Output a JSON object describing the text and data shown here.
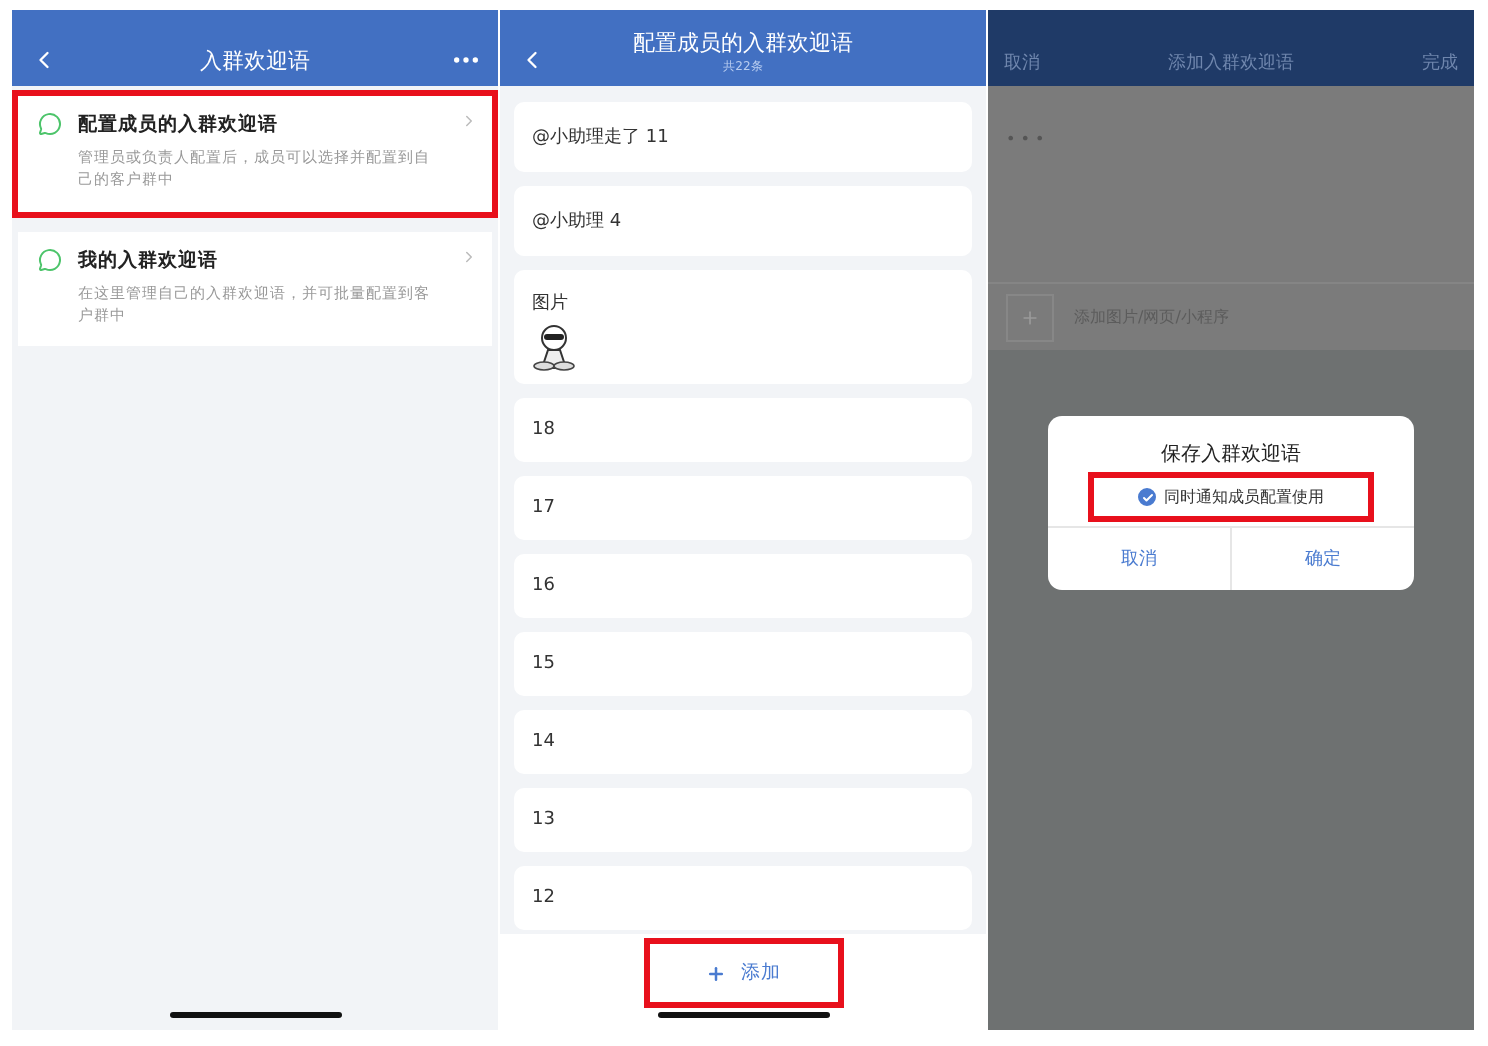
{
  "menu_screen": {
    "title": "入群欢迎语",
    "items": [
      {
        "title": "配置成员的入群欢迎语",
        "description": "管理员或负责人配置后，成员可以选择并配置到自己的客户群中",
        "highlighted": true
      },
      {
        "title": "我的入群欢迎语",
        "description": "在这里管理自己的入群欢迎语，并可批量配置到客户群中",
        "highlighted": false
      }
    ]
  },
  "list_screen": {
    "title": "配置成员的入群欢迎语",
    "subtitle": "共22条",
    "items": [
      {
        "kind": "text",
        "text": "@小助理走了 11"
      },
      {
        "kind": "text",
        "text": "@小助理 4"
      },
      {
        "text": "图片"
      },
      {
        "kind": "text",
        "text": "18"
      },
      {
        "kind": "text",
        "text": "17"
      },
      {
        "kind": "text",
        "text": "16"
      },
      {
        "kind": "text",
        "text": "15"
      },
      {
        "kind": "text",
        "text": "14"
      },
      {
        "kind": "text",
        "text": "13"
      },
      {
        "kind": "text",
        "text": "12"
      }
    ],
    "add_button": {
      "label": "添加",
      "highlighted": true
    }
  },
  "edit_screen": {
    "cancel": "取消",
    "title": "添加入群欢迎语",
    "done": "完成",
    "content": "• • •",
    "attach": "添加图片/网页/小程序",
    "dialog": {
      "title": "保存入群欢迎语",
      "option": {
        "label": "同时通知成员配置使用",
        "checked": true,
        "highlighted": true
      },
      "buttons": [
        "取消",
        "确定"
      ]
    }
  }
}
